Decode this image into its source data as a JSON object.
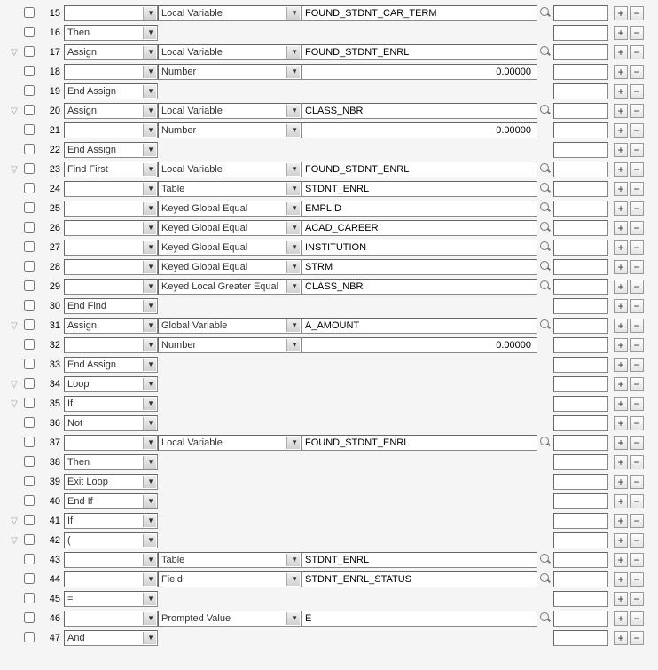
{
  "icons": {
    "mag": "search-icon",
    "plus": "+",
    "minus": "−",
    "expand": "▽"
  },
  "rows": [
    {
      "n": 15,
      "expand": false,
      "keyword": "",
      "type": "Local Variable",
      "value": "FOUND_STDNT_CAR_TERM",
      "numeric": false,
      "lookup": true
    },
    {
      "n": 16,
      "expand": false,
      "keyword": "Then",
      "type": "",
      "value": "",
      "numeric": false,
      "lookup": false
    },
    {
      "n": 17,
      "expand": true,
      "keyword": "Assign",
      "type": "Local Variable",
      "value": "FOUND_STDNT_ENRL",
      "numeric": false,
      "lookup": true
    },
    {
      "n": 18,
      "expand": false,
      "keyword": "",
      "type": "Number",
      "value": "0.00000",
      "numeric": true,
      "lookup": false
    },
    {
      "n": 19,
      "expand": false,
      "keyword": "End Assign",
      "type": "",
      "value": "",
      "numeric": false,
      "lookup": false
    },
    {
      "n": 20,
      "expand": true,
      "keyword": "Assign",
      "type": "Local Variable",
      "value": "CLASS_NBR",
      "numeric": false,
      "lookup": true
    },
    {
      "n": 21,
      "expand": false,
      "keyword": "",
      "type": "Number",
      "value": "0.00000",
      "numeric": true,
      "lookup": false
    },
    {
      "n": 22,
      "expand": false,
      "keyword": "End Assign",
      "type": "",
      "value": "",
      "numeric": false,
      "lookup": false
    },
    {
      "n": 23,
      "expand": true,
      "keyword": "Find First",
      "type": "Local Variable",
      "value": "FOUND_STDNT_ENRL",
      "numeric": false,
      "lookup": true
    },
    {
      "n": 24,
      "expand": false,
      "keyword": "",
      "type": "Table",
      "value": "STDNT_ENRL",
      "numeric": false,
      "lookup": true
    },
    {
      "n": 25,
      "expand": false,
      "keyword": "",
      "type": "Keyed Global Equal",
      "value": "EMPLID",
      "numeric": false,
      "lookup": true
    },
    {
      "n": 26,
      "expand": false,
      "keyword": "",
      "type": "Keyed Global Equal",
      "value": "ACAD_CAREER",
      "numeric": false,
      "lookup": true
    },
    {
      "n": 27,
      "expand": false,
      "keyword": "",
      "type": "Keyed Global Equal",
      "value": "INSTITUTION",
      "numeric": false,
      "lookup": true
    },
    {
      "n": 28,
      "expand": false,
      "keyword": "",
      "type": "Keyed Global Equal",
      "value": "STRM",
      "numeric": false,
      "lookup": true
    },
    {
      "n": 29,
      "expand": false,
      "keyword": "",
      "type": "Keyed Local Greater Equal",
      "value": "CLASS_NBR",
      "numeric": false,
      "lookup": true
    },
    {
      "n": 30,
      "expand": false,
      "keyword": "End Find",
      "type": "",
      "value": "",
      "numeric": false,
      "lookup": false
    },
    {
      "n": 31,
      "expand": true,
      "keyword": "Assign",
      "type": "Global Variable",
      "value": "A_AMOUNT",
      "numeric": false,
      "lookup": true
    },
    {
      "n": 32,
      "expand": false,
      "keyword": "",
      "type": "Number",
      "value": "0.00000",
      "numeric": true,
      "lookup": false
    },
    {
      "n": 33,
      "expand": false,
      "keyword": "End Assign",
      "type": "",
      "value": "",
      "numeric": false,
      "lookup": false
    },
    {
      "n": 34,
      "expand": true,
      "keyword": "Loop",
      "type": "",
      "value": "",
      "numeric": false,
      "lookup": false
    },
    {
      "n": 35,
      "expand": true,
      "keyword": "If",
      "type": "",
      "value": "",
      "numeric": false,
      "lookup": false
    },
    {
      "n": 36,
      "expand": false,
      "keyword": "Not",
      "type": "",
      "value": "",
      "numeric": false,
      "lookup": false
    },
    {
      "n": 37,
      "expand": false,
      "keyword": "",
      "type": "Local Variable",
      "value": "FOUND_STDNT_ENRL",
      "numeric": false,
      "lookup": true
    },
    {
      "n": 38,
      "expand": false,
      "keyword": "Then",
      "type": "",
      "value": "",
      "numeric": false,
      "lookup": false
    },
    {
      "n": 39,
      "expand": false,
      "keyword": "Exit Loop",
      "type": "",
      "value": "",
      "numeric": false,
      "lookup": false
    },
    {
      "n": 40,
      "expand": false,
      "keyword": "End If",
      "type": "",
      "value": "",
      "numeric": false,
      "lookup": false
    },
    {
      "n": 41,
      "expand": true,
      "keyword": "If",
      "type": "",
      "value": "",
      "numeric": false,
      "lookup": false
    },
    {
      "n": 42,
      "expand": true,
      "keyword": "(",
      "type": "",
      "value": "",
      "numeric": false,
      "lookup": false
    },
    {
      "n": 43,
      "expand": false,
      "keyword": "",
      "type": "Table",
      "value": "STDNT_ENRL",
      "numeric": false,
      "lookup": true
    },
    {
      "n": 44,
      "expand": false,
      "keyword": "",
      "type": "Field",
      "value": "STDNT_ENRL_STATUS",
      "numeric": false,
      "lookup": true
    },
    {
      "n": 45,
      "expand": false,
      "keyword": "=",
      "type": "",
      "value": "",
      "numeric": false,
      "lookup": false
    },
    {
      "n": 46,
      "expand": false,
      "keyword": "",
      "type": "Prompted Value",
      "value": "E",
      "numeric": false,
      "lookup": true
    },
    {
      "n": 47,
      "expand": false,
      "keyword": "And",
      "type": "",
      "value": "",
      "numeric": false,
      "lookup": false
    }
  ]
}
